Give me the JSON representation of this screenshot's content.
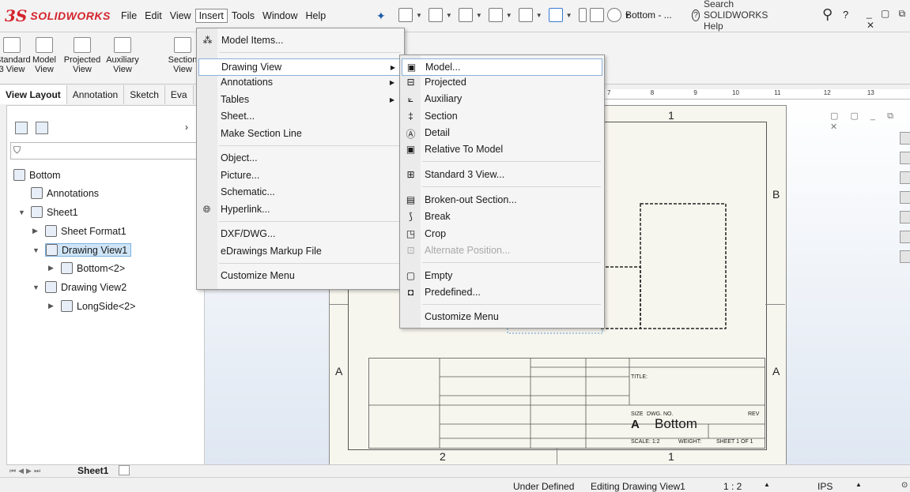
{
  "app": {
    "logo_prefix": "3S",
    "logo_text": "SOLIDWORKS"
  },
  "menubar": [
    "File",
    "Edit",
    "View",
    "Insert",
    "Tools",
    "Window",
    "Help"
  ],
  "toolbar": {
    "view_dropdown": "Bottom - ...",
    "search_placeholder": "Search SOLIDWORKS Help",
    "help_label": "?"
  },
  "command_manager": [
    {
      "label1": "Standard",
      "label2": "3 View"
    },
    {
      "label1": "Model",
      "label2": "View"
    },
    {
      "label1": "Projected",
      "label2": "View"
    },
    {
      "label1": "Auxiliary",
      "label2": "View"
    },
    {
      "label1": "Section",
      "label2": "View"
    }
  ],
  "tabs": [
    "View Layout",
    "Annotation",
    "Sketch",
    "Eva"
  ],
  "tree": {
    "root": "Bottom",
    "annotations": "Annotations",
    "sheet": "Sheet1",
    "sheet_format": "Sheet Format1",
    "view1": "Drawing View1",
    "view1_child": "Bottom<2>",
    "view2": "Drawing View2",
    "view2_child": "LongSide<2>"
  },
  "insert_menu": {
    "items": [
      "Model Items...",
      "Drawing View",
      "Annotations",
      "Tables",
      "Sheet...",
      "Make Section Line",
      "Object...",
      "Picture...",
      "Schematic...",
      "Hyperlink...",
      "DXF/DWG...",
      "eDrawings Markup File",
      "Customize Menu"
    ]
  },
  "drawing_view_menu": {
    "items": [
      "Model...",
      "Projected",
      "Auxiliary",
      "Section",
      "Detail",
      "Relative To Model",
      "Standard 3 View...",
      "Broken-out Section...",
      "Break",
      "Crop",
      "Alternate Position...",
      "Empty",
      "Predefined...",
      "Customize Menu"
    ]
  },
  "sheet": {
    "zone_top": "1",
    "zone_bottom_left": "2",
    "zone_bottom_right": "1",
    "zone_b": "B",
    "zone_a_left": "A",
    "zone_a_right": "A",
    "title_label": "TITLE:",
    "size_label": "SIZE",
    "dwg_label": "DWG. NO.",
    "rev_label": "REV",
    "size_value": "A",
    "dwg_value": "Bottom",
    "scale_label": "SCALE: 1:2",
    "weight_label": "WEIGHT:",
    "sheet_label": "SHEET 1 OF 1"
  },
  "ruler_ticks": [
    "7",
    "8",
    "9",
    "10",
    "11",
    "12",
    "13"
  ],
  "sheet_tab": "Sheet1",
  "status": {
    "defined": "Under Defined",
    "editing": "Editing Drawing View1",
    "scale": "1 : 2",
    "units": "IPS"
  },
  "colors": {
    "brand": "#d4242c",
    "highlight": "#cfe5f7",
    "sheet": "#f7f6ee"
  }
}
